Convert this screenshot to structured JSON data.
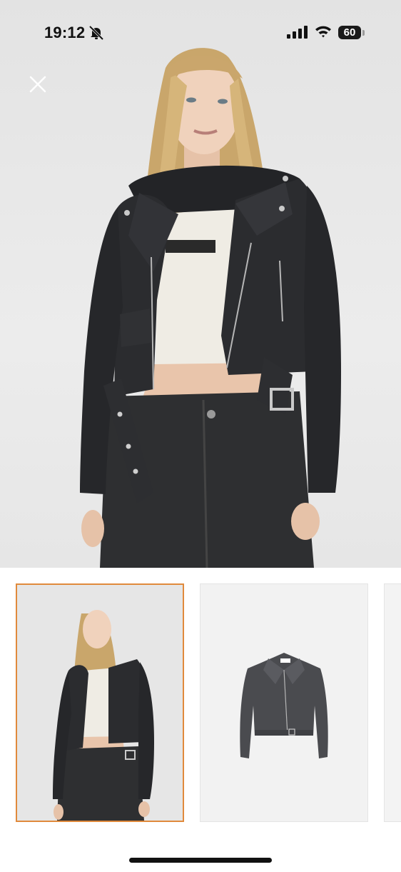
{
  "status_bar": {
    "time": "19:12",
    "battery": "60",
    "icons": [
      "bell-slash-icon",
      "signal-icon",
      "wifi-icon",
      "battery-icon"
    ]
  },
  "toolbar": {
    "close_icon": "close-icon"
  },
  "hero": {
    "image": "model-wearing-cropped-black-faux-leather-biker-jacket"
  },
  "gallery": {
    "selected_index": 0,
    "thumbnails": [
      {
        "image": "model-wearing-jacket-thumbnail"
      },
      {
        "image": "jacket-flat-lay-thumbnail"
      },
      {
        "image": "partial-thumbnail"
      }
    ]
  },
  "colors": {
    "selected_border": "#e08a3c",
    "jacket": "#2b2c2f",
    "background": "#e8e8e8"
  }
}
